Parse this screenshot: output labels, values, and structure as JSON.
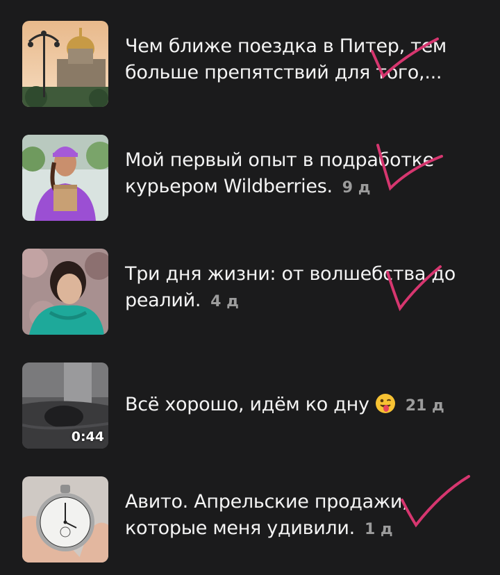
{
  "feed": {
    "items": [
      {
        "title": "Чем ближе поездка в Питер, тем больше препятствий для того,...",
        "age": ""
      },
      {
        "title": "Мой первый опыт в подработке курьером Wildberries.",
        "age": "9 д"
      },
      {
        "title": "Три дня жизни: от волшебства до реалий.",
        "age": "4 д"
      },
      {
        "title": "Всё хорошо, идём ко дну",
        "age": "21 д",
        "duration": "0:44",
        "emoji": "winking-face-with-tongue"
      },
      {
        "title": "Авито. Апрельские продажи, которые меня удивили.",
        "age": "1 д"
      }
    ]
  },
  "colors": {
    "background": "#1b1b1c",
    "text": "#f4f4f4",
    "muted": "#9c9c9c",
    "annotation": "#d6366f"
  }
}
